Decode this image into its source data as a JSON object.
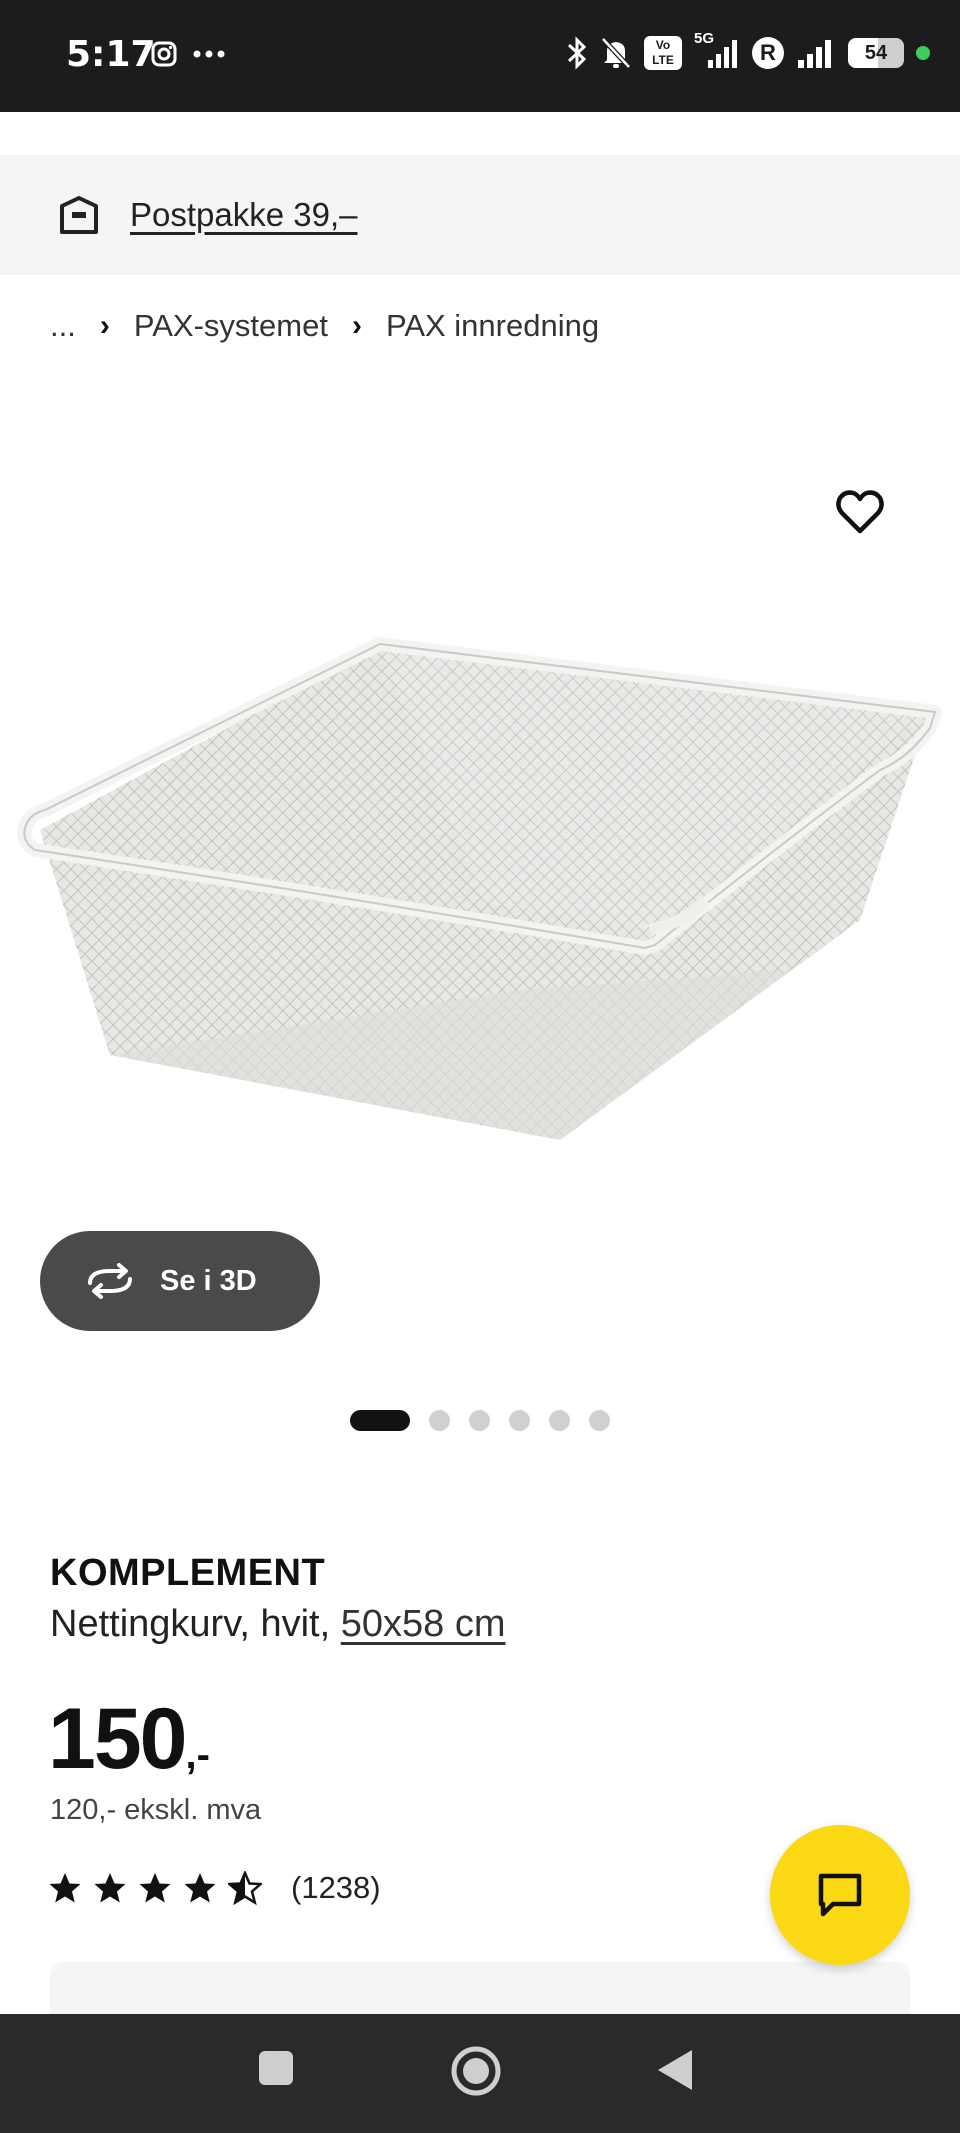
{
  "status_bar": {
    "time": "5:17",
    "network": "5G",
    "volte": "Vo LTE",
    "roaming": "R",
    "battery_level": "54",
    "battery_percent": 54,
    "icons": [
      "instagram-icon",
      "more-icon",
      "bluetooth-icon",
      "mute-icon",
      "signal-icon",
      "battery-icon"
    ]
  },
  "delivery": {
    "label": "Postpakke 39,–",
    "icon": "parcel-truck-icon"
  },
  "breadcrumb": {
    "ellipsis": "...",
    "items": [
      "PAX-systemet",
      "PAX innredning"
    ]
  },
  "product": {
    "favourite_icon": "heart-icon",
    "view3d_label": "Se i 3D",
    "image_count": 6,
    "active_image": 1,
    "brand": "KOMPLEMENT",
    "description": "Nettingkurv, hvit,",
    "size": "50x58 cm",
    "price": "150",
    "price_suffix": ",-",
    "price_ex_vat": "120,- ekskl. mva",
    "rating": 4.5,
    "review_count": "(1238)"
  },
  "colors": {
    "accent_yellow": "#fbd914",
    "dark": "#111111",
    "button_grey": "#4a4a4a"
  },
  "chat_icon": "chat-icon",
  "nav": [
    "recents-button",
    "home-button",
    "back-button"
  ]
}
